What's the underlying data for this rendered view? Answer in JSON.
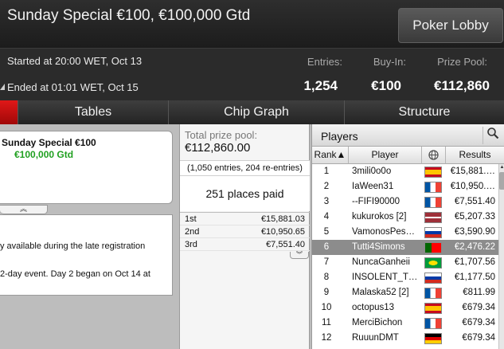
{
  "header": {
    "title": "Sunday Special €100, €100,000 Gtd",
    "lobby_button": "Poker Lobby"
  },
  "info": {
    "started": "Started at 20:00 WET, Oct 13",
    "ended": "Ended at 01:01 WET, Oct 15",
    "entries_label": "Entries:",
    "entries": "1,254",
    "buyin_label": "Buy-In:",
    "buyin": "€100",
    "prize_label": "Prize Pool:",
    "prize": "€112,860"
  },
  "tabs": [
    "Tables",
    "Chip Graph",
    "Structure"
  ],
  "tournament_card": {
    "name": "Sunday Special €100",
    "guarantee": "€100,000 Gtd",
    "expand_icon": "double-chevron-up"
  },
  "description": {
    "line1": "y available during the late registration",
    "line2": "2-day event. Day 2 began on Oct 14 at"
  },
  "prize_pool": {
    "label": "Total prize pool:",
    "value": "€112,860.00",
    "entries_note": "(1,050 entries, 204 re-entries)",
    "places_paid": "251 places paid",
    "payouts": [
      {
        "place": "1st",
        "amount": "€15,881.03"
      },
      {
        "place": "2nd",
        "amount": "€10,950.65"
      },
      {
        "place": "3rd",
        "amount": "€7,551.40"
      }
    ],
    "expand_icon": "double-chevron-down"
  },
  "players": {
    "title": "Players",
    "search_icon": "magnifier",
    "columns": {
      "rank": "Rank▲",
      "player": "Player",
      "country_icon": "globe",
      "results": "Results"
    },
    "rows": [
      {
        "rank": "1",
        "name": "3mili0o0o",
        "flag": "Spain",
        "result": "€15,881.…"
      },
      {
        "rank": "2",
        "name": "IaWeen31",
        "flag": "France",
        "result": "€10,950.…"
      },
      {
        "rank": "3",
        "name": "--FIFI90000",
        "flag": "France",
        "result": "€7,551.40"
      },
      {
        "rank": "4",
        "name": "kukurokos [2]",
        "flag": "Latvia",
        "result": "€5,207.33"
      },
      {
        "rank": "5",
        "name": "VamonosPes…",
        "flag": "Russia",
        "result": "€3,590.90"
      },
      {
        "rank": "6",
        "name": "Tutti4Simons",
        "flag": "Portugal",
        "result": "€2,476.22",
        "selected": true
      },
      {
        "rank": "7",
        "name": "NuncaGanheii",
        "flag": "Brazil",
        "result": "€1,707.56"
      },
      {
        "rank": "8",
        "name": "INSOLENT_T…",
        "flag": "Russia",
        "result": "€1,177.50"
      },
      {
        "rank": "9",
        "name": "Malaska52 [2]",
        "flag": "France",
        "result": "€811.99"
      },
      {
        "rank": "10",
        "name": "octopus13",
        "flag": "Spain",
        "result": "€679.34"
      },
      {
        "rank": "11",
        "name": "MerciBichon",
        "flag": "France",
        "result": "€679.34"
      },
      {
        "rank": "12",
        "name": "RuuunDMT",
        "flag": "Germany",
        "result": "€679.34"
      }
    ]
  },
  "colors": {
    "accent_red": "#d01010",
    "guarantee_green": "#20a020",
    "selected_row": "#8c8c8c"
  }
}
